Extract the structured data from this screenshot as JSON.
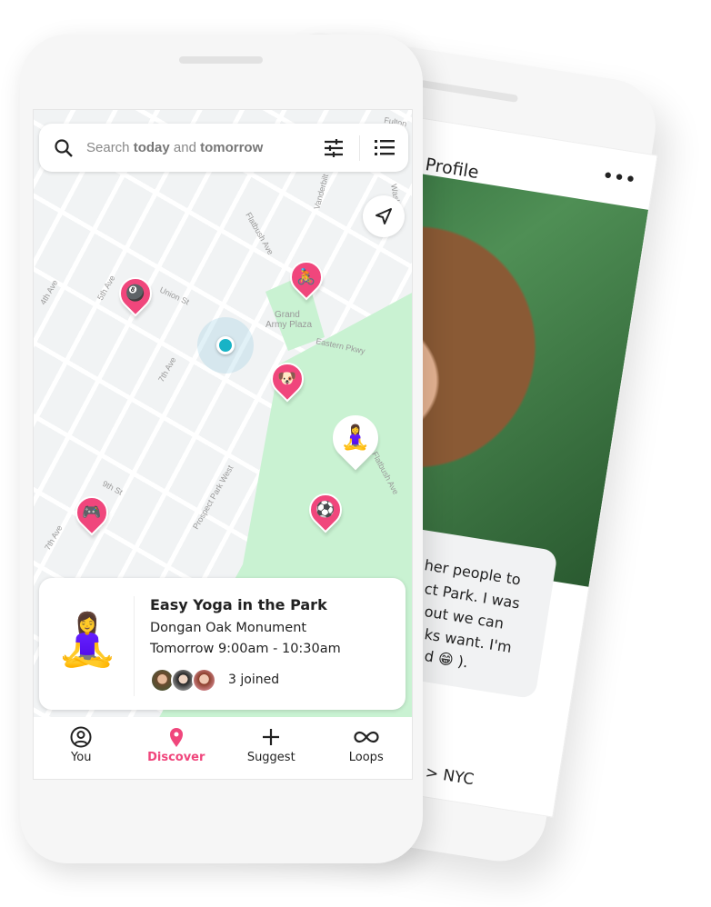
{
  "profile_phone": {
    "title": "Profile",
    "more_icon": "ellipsis-icon",
    "bio_lines": [
      "her people to",
      "ct Park. I was",
      "out we can",
      "ks want. I'm",
      "d 😁 )."
    ],
    "location": "> NYC"
  },
  "search": {
    "placeholder_prefix": "Search ",
    "word1": "today",
    "mid": " and ",
    "word2": "tomorrow",
    "filter_icon": "sliders-icon",
    "list_icon": "list-icon"
  },
  "map": {
    "labels": [
      "Fulton",
      "Flatbush Ave",
      "Vanderbilt",
      "Washington",
      "4th Ave",
      "5th Ave",
      "Union St",
      "Grand",
      "Army Plaza",
      "Eastern Pkwy",
      "7th Ave",
      "Prospect Park West",
      "9th St",
      "7th Ave",
      "Flatbush Ave"
    ],
    "pins": [
      {
        "emoji": "🎱",
        "name": "billiards"
      },
      {
        "emoji": "🚴",
        "name": "cycling"
      },
      {
        "emoji": "🐶",
        "name": "dog"
      },
      {
        "emoji": "🧘‍♀️",
        "name": "yoga",
        "selected": true
      },
      {
        "emoji": "⚽",
        "name": "soccer"
      },
      {
        "emoji": "🎮",
        "name": "gaming"
      }
    ],
    "colors": {
      "pin": "#f0467c",
      "park": "#c9f2d2",
      "user": "#18b3c6"
    }
  },
  "event_card": {
    "emoji": "🧘‍♀️",
    "title": "Easy Yoga in the Park",
    "place": "Dongan Oak Monument",
    "time": "Tomorrow 9:00am - 10:30am",
    "joined": "3 joined"
  },
  "nav": [
    {
      "label": "You",
      "icon": "user-circle-icon"
    },
    {
      "label": "Discover",
      "icon": "map-pin-icon",
      "active": true
    },
    {
      "label": "Suggest",
      "icon": "plus-icon"
    },
    {
      "label": "Loops",
      "icon": "infinity-icon"
    }
  ]
}
